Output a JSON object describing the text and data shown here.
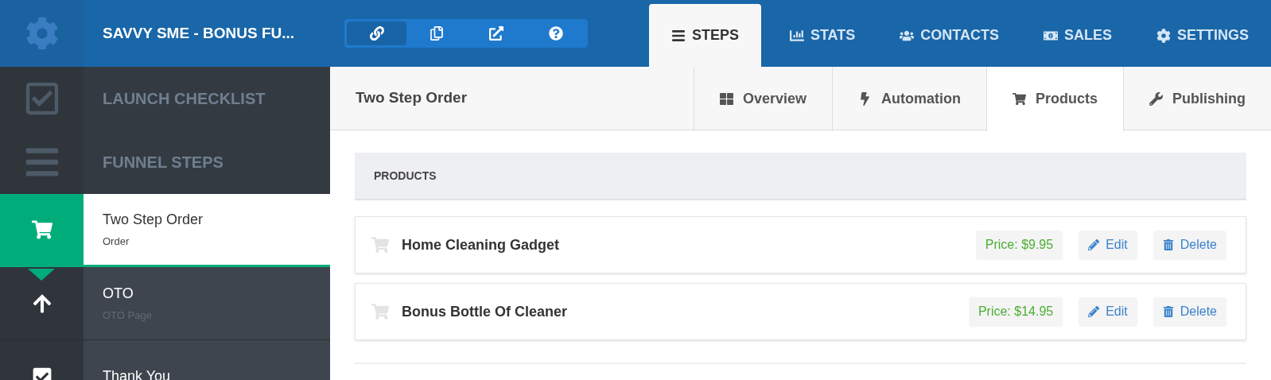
{
  "funnel": {
    "title": "SAVVY SME - BONUS FU..."
  },
  "toolbar": [
    {
      "kind": "link",
      "selected": true
    },
    {
      "kind": "copy",
      "selected": false
    },
    {
      "kind": "external",
      "selected": false
    },
    {
      "kind": "help",
      "selected": false
    }
  ],
  "main_tabs": [
    {
      "kind": "steps",
      "label": "STEPS",
      "selected": true
    },
    {
      "kind": "stats",
      "label": "STATS",
      "selected": false
    },
    {
      "kind": "contacts",
      "label": "CONTACTS",
      "selected": false
    },
    {
      "kind": "sales",
      "label": "SALES",
      "selected": false
    },
    {
      "kind": "settings",
      "label": "SETTINGS",
      "selected": false
    }
  ],
  "sidebar": {
    "sections": [
      {
        "kind": "checklist",
        "label": "LAUNCH CHECKLIST"
      },
      {
        "kind": "steps",
        "label": "FUNNEL STEPS"
      }
    ],
    "steps": [
      {
        "kind": "order",
        "title": "Two Step Order",
        "subtitle": "Order",
        "selected": true
      },
      {
        "kind": "upsell",
        "title": "OTO",
        "subtitle": "OTO Page",
        "selected": false
      },
      {
        "kind": "thanks",
        "title": "Thank You",
        "selected": false
      }
    ]
  },
  "page": {
    "title": "Two Step Order"
  },
  "sub_tabs": [
    {
      "kind": "overview",
      "label": "Overview",
      "selected": false
    },
    {
      "kind": "automation",
      "label": "Automation",
      "selected": false
    },
    {
      "kind": "products",
      "label": "Products",
      "selected": true
    },
    {
      "kind": "publishing",
      "label": "Publishing",
      "selected": false
    }
  ],
  "products": {
    "heading": "PRODUCTS",
    "items": [
      {
        "name": "Home Cleaning Gadget",
        "price": "Price: $9.95",
        "edit_label": "Edit",
        "delete_label": "Delete"
      },
      {
        "name": "Bonus Bottle Of Cleaner",
        "price": "Price: $14.95",
        "edit_label": "Edit",
        "delete_label": "Delete"
      }
    ]
  }
}
